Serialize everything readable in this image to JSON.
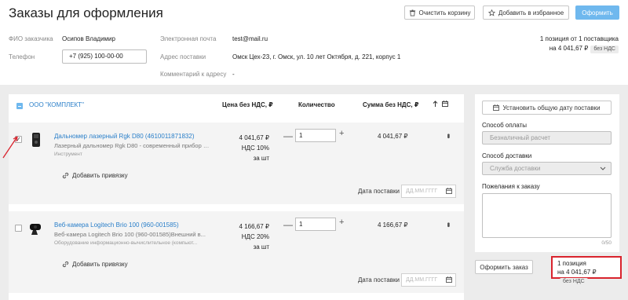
{
  "header": {
    "title": "Заказы для оформления",
    "clear_cart_label": "Очистить корзину",
    "add_favorites_label": "Добавить в избранное",
    "checkout_label": "Оформить"
  },
  "customer": {
    "name_label": "ФИО заказчика",
    "name_value": "Осипов Владимир",
    "phone_label": "Телефон",
    "phone_value": "+7 (925) 100-00-00",
    "email_label": "Электронная почта",
    "email_value": "test@mail.ru",
    "address_label": "Адрес поставки",
    "address_value": "Омск Цех-23, г. Омск, ул. 10 лет Октября, д. 221, корпус 1",
    "comment_label": "Комментарий к адресу",
    "comment_value": "-"
  },
  "summary_top": {
    "line1": "1 позиция от 1 поставщика",
    "amount": "на 4 041,67 ₽",
    "vat_badge": "без НДС"
  },
  "table": {
    "supplier_name": "ООО \"КОМПЛЕКТ\"",
    "col_price": "Цена без НДС, ₽",
    "col_qty": "Количество",
    "col_sum": "Сумма без НДС, ₽"
  },
  "items": [
    {
      "checked": true,
      "check_mark": "✓",
      "name": "Дальномер лазерный Rgk D80 (4610011871832)",
      "description": "Лазерный дальномер Rgk D80 - современный прибор пр...",
      "category": "Инструмент",
      "bind_label": "Добавить привязку",
      "price": "4 041,67 ₽",
      "vat": "НДС 10%",
      "unit": "за шт",
      "qty": "1",
      "sum": "4 041,67 ₽",
      "date_label": "Дата поставки",
      "date_placeholder": "ДД.ММ.ГГГГ"
    },
    {
      "checked": false,
      "check_mark": "",
      "name": "Веб-камера Logitech Brio 100 (960-001585)",
      "description": "Веб-камера Logitech Brio 100 (960-001585)Внешний в...",
      "category": "Оборудование информационно-вычислительное (компьют...",
      "bind_label": "Добавить привязку",
      "price": "4 166,67 ₽",
      "vat": "НДС 20%",
      "unit": "за шт",
      "qty": "1",
      "sum": "4 166,67 ₽",
      "date_label": "Дата поставки",
      "date_placeholder": "ДД.ММ.ГГГГ"
    }
  ],
  "side": {
    "set_date_label": "Установить общую дату поставки",
    "payment_label": "Способ оплаты",
    "payment_value": "Безналичный расчет",
    "delivery_label": "Способ доставки",
    "delivery_value": "Служба доставки",
    "wishes_label": "Пожелания к заказу",
    "counter": "0/50"
  },
  "footer": {
    "place_order_label": "Оформить заказ",
    "total_line1": "1 позиция",
    "total_amount": "на 4 041,67 ₽",
    "vat_badge": "без НДС"
  },
  "colors": {
    "accent": "#6fb8ee",
    "link": "#2a7fc9",
    "highlight": "#d9232d"
  }
}
